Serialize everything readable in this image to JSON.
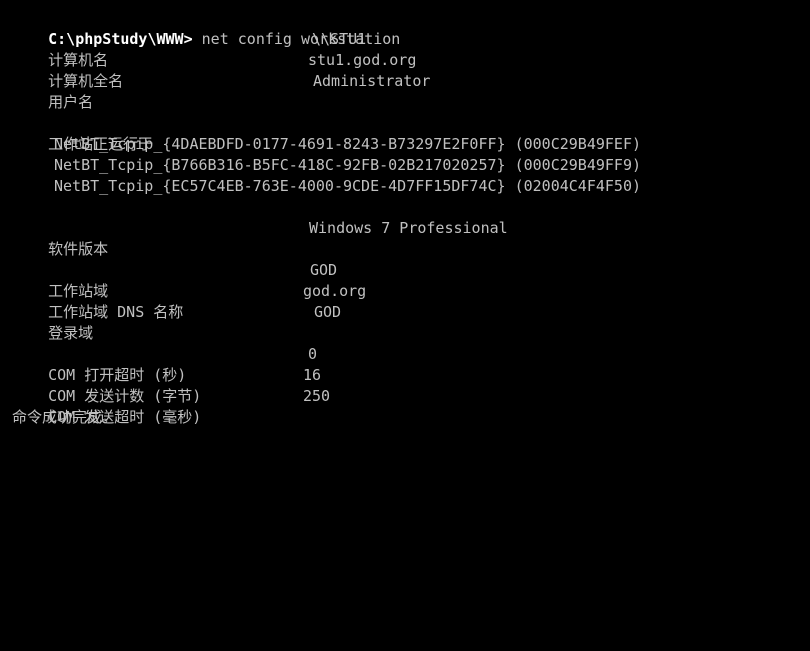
{
  "terminal": {
    "prompt": "C:\\phpStudy\\WWW>",
    "command": " net config workstation",
    "rows": {
      "computer_name": {
        "label": "计算机名",
        "value": "\\\\STU1"
      },
      "full_computer_name": {
        "label": "计算机全名",
        "value": "stu1.god.org"
      },
      "user_name": {
        "label": "用户名",
        "value": "Administrator"
      },
      "active_on": {
        "label": "工作站正运行于"
      },
      "adapters": [
        "NetBT_Tcpip_{4DAEBDFD-0177-4691-8243-B73297E2F0FF} (000C29B49FEF)",
        "NetBT_Tcpip_{B766B316-B5FC-418C-92FB-02B217020257} (000C29B49FF9)",
        "NetBT_Tcpip_{EC57C4EB-763E-4000-9CDE-4D7FF15DF74C} (02004C4F4F50)"
      ],
      "software_version": {
        "label": "软件版本",
        "value": "Windows 7 Professional"
      },
      "workstation_domain": {
        "label": "工作站域",
        "value": "GOD"
      },
      "workstation_dns_name": {
        "label": "工作站域 DNS 名称",
        "value": "god.org"
      },
      "logon_domain": {
        "label": "登录域",
        "value": "GOD"
      },
      "com_open_timeout": {
        "label": "COM 打开超时 (秒)",
        "value": "0"
      },
      "com_send_count": {
        "label": "COM 发送计数 (字节)",
        "value": "16"
      },
      "com_send_timeout": {
        "label": "COM 发送超时 (毫秒)",
        "value": "250"
      },
      "completion": "命令成功完成。"
    }
  }
}
